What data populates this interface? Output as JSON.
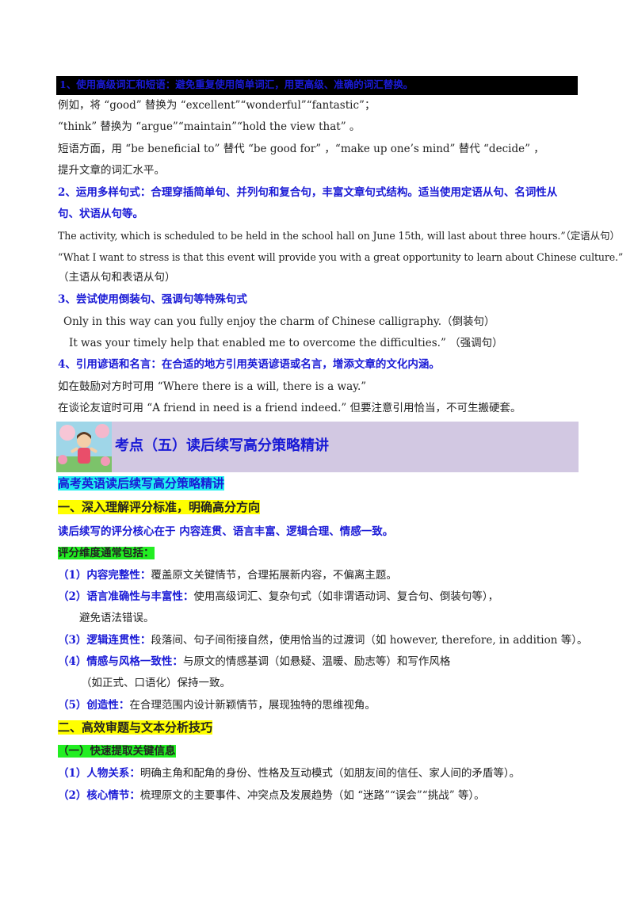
{
  "section1": {
    "heading": "1、使用高级词汇和短语：避免重复使用简单词汇，用更高级、准确的词汇替换。",
    "line1": "例如，将 “good” 替换为 “excellent”“wonderful”“fantastic”；",
    "line2": "“think” 替换为 “argue”“maintain”“hold the view that” 。",
    "line3": "短语方面，用 “be beneficial to” 替代 “be good for” ，“make up one’s mind” 替代 “decide” ，",
    "line4": "提升文章的词汇水平。"
  },
  "section2": {
    "heading_a": "2、运用多样句式：合理穿插简单句、并列句和复合句，丰富文章句式结构。适当使用定语从句、名词性从",
    "heading_b": "句、状语从句等。",
    "ex1": "The activity, which is scheduled to be held in the school hall on June 15th, will last about three hours.”（定语从句）",
    "ex2": "“What I want to stress is that this event will provide you with a great opportunity to learn about Chinese culture.”",
    "ex2_note": "（主语从句和表语从句）"
  },
  "section3": {
    "heading": "3、尝试使用倒装句、强调句等特殊句式",
    "ex1": "Only in this way can you fully enjoy the charm of Chinese calligraphy.（倒装句）",
    "ex2": "It was your timely help that enabled me to overcome the difficulties.” （强调句）"
  },
  "section4": {
    "heading": "4、引用谚语和名言：在合适的地方引用英语谚语或名言，增添文章的文化内涵。",
    "ex1": "如在鼓励对方时可用 “Where there is a will, there is a way.”",
    "ex2": "在谈论友谊时可用 “A friend in need is a friend indeed.” 但要注意引用恰当，不可生搬硬套。"
  },
  "banner": {
    "title": "考点（五）读后续写高分策略精讲"
  },
  "part": {
    "subtitle": "高考英语读后续写高分策略精讲",
    "h1": "一、深入理解评分标准，明确高分方向",
    "core": "读后续写的评分核心在于 内容连贯、语言丰富、逻辑合理、情感一致。",
    "dims_label": "评分维度通常包括：",
    "items": [
      {
        "num": "（1）",
        "key": "内容完整性：",
        "text": "覆盖原文关键情节，合理拓展新内容，不偏离主题。"
      },
      {
        "num": "（2）",
        "key": "语言准确性与丰富性：",
        "text": "使用高级词汇、复杂句式（如非谓语动词、复合句、倒装句等），"
      },
      {
        "num": "（3）",
        "key": "逻辑连贯性：",
        "text": "段落间、句子间衔接自然，使用恰当的过渡词（如 however, therefore, in addition 等）。"
      },
      {
        "num": "（4）",
        "key": "情感与风格一致性：",
        "text": "与原文的情感基调（如悬疑、温暖、励志等）和写作风格"
      },
      {
        "num": "（5）",
        "key": "创造性：",
        "text": "在合理范围内设计新颖情节，展现独特的思维视角。"
      }
    ],
    "item2_cont": "避免语法错误。",
    "item4_cont": "（如正式、口语化）保持一致。",
    "h2": "二、高效审题与文本分析技巧",
    "h2_sub": "（一）快速提取关键信息",
    "items2": [
      {
        "num": "（1）",
        "key": "人物关系：",
        "text": "明确主角和配角的身份、性格及互动模式（如朋友间的信任、家人间的矛盾等）。"
      },
      {
        "num": "（2）",
        "key": "核心情节：",
        "text": "梳理原文的主要事件、冲突点及发展趋势（如 “迷路”“误会”“挑战” 等）。"
      }
    ]
  },
  "colors": {
    "accent_blue": "#1a1ad6",
    "banner_bg": "#d2c8e2",
    "highlight_cyan": "#22f0f0",
    "highlight_yellow": "#ffff00",
    "highlight_green": "#22ee22"
  }
}
